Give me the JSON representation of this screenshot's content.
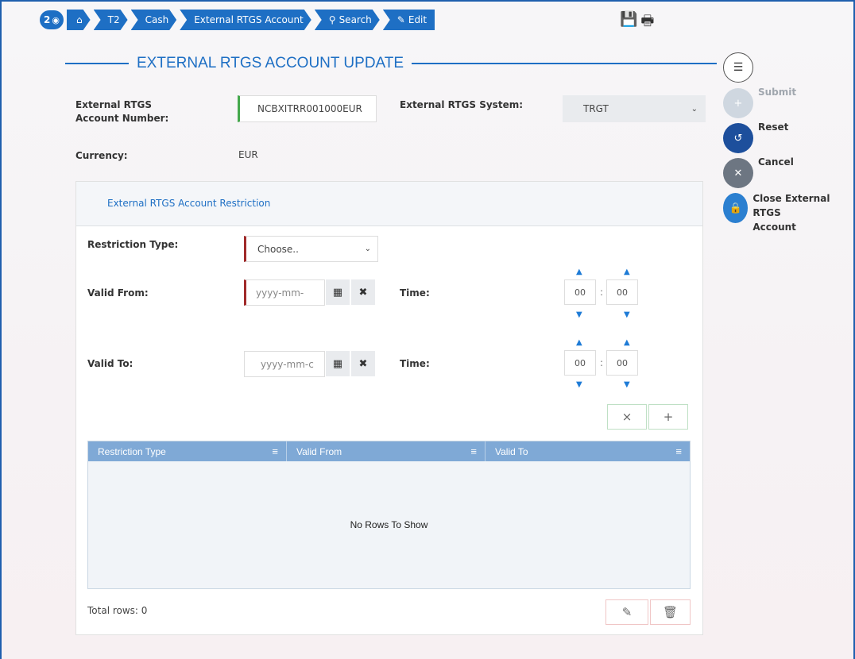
{
  "breadcrumb": {
    "counter": "2",
    "items": [
      "T2",
      "Cash",
      "External RTGS Account",
      "Search",
      "Edit"
    ]
  },
  "page_title": "EXTERNAL RTGS ACCOUNT UPDATE",
  "form": {
    "account_number_label": "External RTGS Account Number:",
    "account_number_value": "NCBXITRR001000EUR",
    "system_label": "External RTGS System:",
    "system_value": "TRGT",
    "currency_label": "Currency:",
    "currency_value": "EUR"
  },
  "restriction_panel": {
    "title": "External RTGS Account Restriction",
    "restriction_type_label": "Restriction Type:",
    "restriction_type_value": "Choose..",
    "valid_from_label": "Valid From:",
    "valid_from_placeholder": "yyyy-mm-",
    "valid_to_label": "Valid To:",
    "valid_to_placeholder": "yyyy-mm-c",
    "time_label": "Time:",
    "from_hour": "00",
    "from_minute": "00",
    "to_hour": "00",
    "to_minute": "00",
    "time_separator": ":"
  },
  "grid": {
    "columns": [
      "Restriction Type",
      "Valid From",
      "Valid To"
    ],
    "empty_message": "No Rows To Show",
    "total_rows": "Total rows: 0"
  },
  "actions": {
    "submit": "Submit",
    "reset": "Reset",
    "cancel": "Cancel",
    "close_account_line1": "Close External RTGS",
    "close_account_line2": "Account"
  },
  "colors": {
    "primary": "#1e6fc4",
    "grid_header": "#7fa9d6",
    "required_marker": "#a02a2a",
    "valid_marker": "#44a84c"
  }
}
